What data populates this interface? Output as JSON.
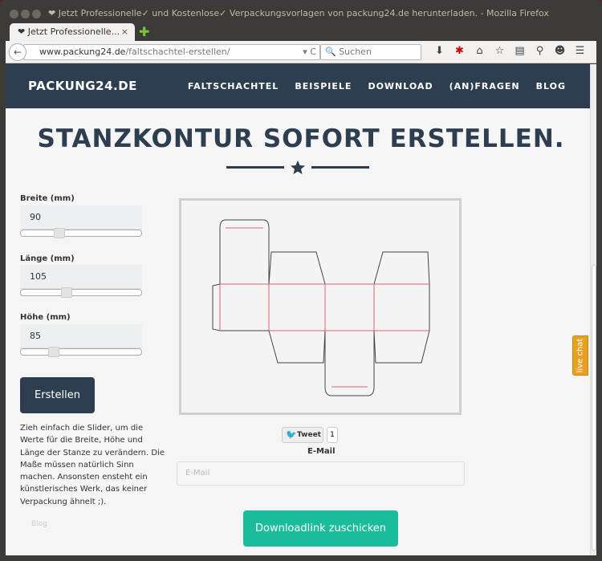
{
  "window": {
    "title": "❤ Jetzt Professionelle✓ und Kostenlose✓ Verpackungsvorlagen von packung24.de herunterladen. - Mozilla Firefox"
  },
  "tab": {
    "label": "❤ Jetzt Professionelle...",
    "close": "×",
    "new": "✚"
  },
  "toolbar": {
    "url_domain": "www.packung24.de",
    "url_path": "/faltschachtel-erstellen/",
    "reload": "▾ C",
    "search_placeholder": "Suchen",
    "back": "←"
  },
  "site": {
    "logo": "PACKUNG24.DE",
    "menu": [
      "FALTSCHACHTEL",
      "BEISPIELE",
      "DOWNLOAD",
      "(AN)FRAGEN",
      "BLOG"
    ],
    "title": "STANZKONTUR SOFORT ERSTELLEN."
  },
  "form": {
    "breite": {
      "label": "Breite (mm)",
      "value": "90",
      "slider": 0.3
    },
    "laenge": {
      "label": "Länge (mm)",
      "value": "105",
      "slider": 0.37
    },
    "hoehe": {
      "label": "Höhe (mm)",
      "value": "85",
      "slider": 0.25
    },
    "button": "Erstellen",
    "help": "Zieh einfach die Slider, um die Werte für die Breite, Höhe und Länge der Stanze zu verändern. Die Maße müssen natürlich Sinn machen. Ansonsten ensteht ein künstlerisches Werk, das keiner Verpackung ähnelt ;).",
    "blog": "Blog"
  },
  "share": {
    "tweet": "Tweet",
    "count": "1"
  },
  "email": {
    "label": "E-Mail",
    "placeholder": "E-Mail",
    "button": "Downloadlink zuschicken"
  },
  "chat": {
    "label": "live chat",
    "color": "#e8a020"
  },
  "colors": {
    "nav": "#2c3e50",
    "accent": "#1abc9c",
    "cut": "#444444",
    "crease": "#e0607a"
  }
}
